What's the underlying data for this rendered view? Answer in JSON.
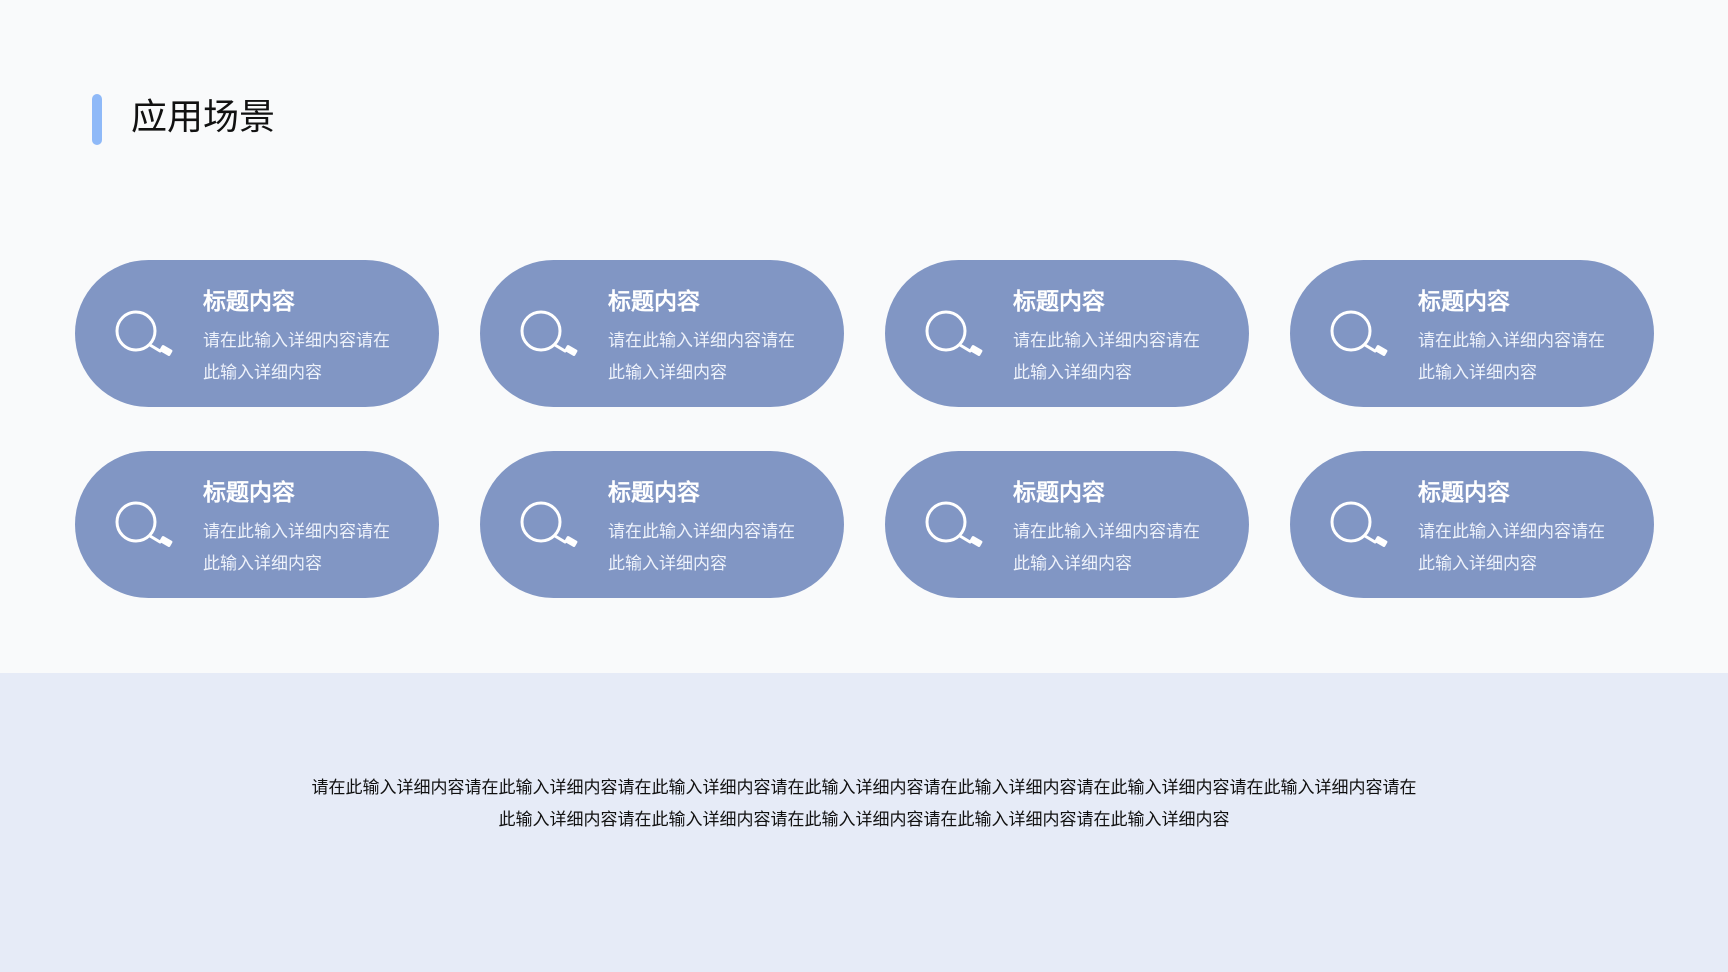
{
  "page": {
    "title": "应用场景"
  },
  "cards": [
    {
      "title": "标题内容",
      "body": "请在此输入详细内容请在此输入详细内容",
      "icon": "search-icon"
    },
    {
      "title": "标题内容",
      "body": "请在此输入详细内容请在此输入详细内容",
      "icon": "search-icon"
    },
    {
      "title": "标题内容",
      "body": "请在此输入详细内容请在此输入详细内容",
      "icon": "search-icon"
    },
    {
      "title": "标题内容",
      "body": "请在此输入详细内容请在此输入详细内容",
      "icon": "search-icon"
    },
    {
      "title": "标题内容",
      "body": "请在此输入详细内容请在此输入详细内容",
      "icon": "search-icon"
    },
    {
      "title": "标题内容",
      "body": "请在此输入详细内容请在此输入详细内容",
      "icon": "search-icon"
    },
    {
      "title": "标题内容",
      "body": "请在此输入详细内容请在此输入详细内容",
      "icon": "search-icon"
    },
    {
      "title": "标题内容",
      "body": "请在此输入详细内容请在此输入详细内容",
      "icon": "search-icon"
    }
  ],
  "footer": {
    "text": "请在此输入详细内容请在此输入详细内容请在此输入详细内容请在此输入详细内容请在此输入详细内容请在此输入详细内容请在此输入详细内容请在此输入详细内容请在此输入详细内容请在此输入详细内容请在此输入详细内容请在此输入详细内容"
  },
  "colors": {
    "page_background": "#f9fafb",
    "accent": "#8fb9f8",
    "card": "#8196c4",
    "footer_background": "#e6ebf7"
  }
}
